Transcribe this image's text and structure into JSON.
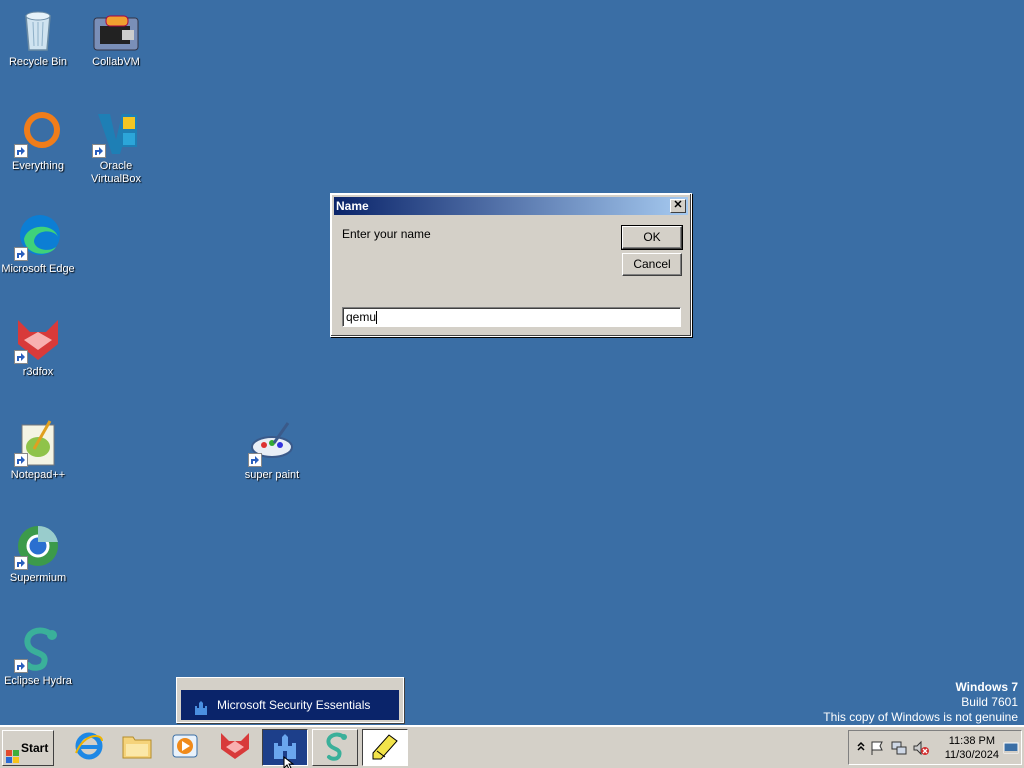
{
  "desktop": {
    "icons": [
      {
        "label": "Recycle Bin"
      },
      {
        "label": "CollabVM"
      },
      {
        "label": "Everything"
      },
      {
        "label": "Oracle VirtualBox"
      },
      {
        "label": "Microsoft Edge"
      },
      {
        "label": "r3dfox"
      },
      {
        "label": "Notepad++"
      },
      {
        "label": "super paint"
      },
      {
        "label": "Supermium"
      },
      {
        "label": "Eclipse Hydra"
      }
    ]
  },
  "dialog": {
    "title": "Name",
    "close_label": "✕",
    "prompt": "Enter your name",
    "ok_label": "OK",
    "cancel_label": "Cancel",
    "input_value": "qemu"
  },
  "notification": {
    "text": "Microsoft Security Essentials"
  },
  "watermark": {
    "line1": "Windows 7",
    "line2": "Build 7601",
    "line3": "This copy of Windows is not genuine"
  },
  "taskbar": {
    "start_label": "Start",
    "clock_time": "11:38 PM",
    "clock_date": "11/30/2024"
  },
  "colors": {
    "desktop_bg": "#3a6ea5",
    "titlebar_start": "#0a246a",
    "titlebar_end": "#a6caf0",
    "face": "#d4d0c8"
  }
}
